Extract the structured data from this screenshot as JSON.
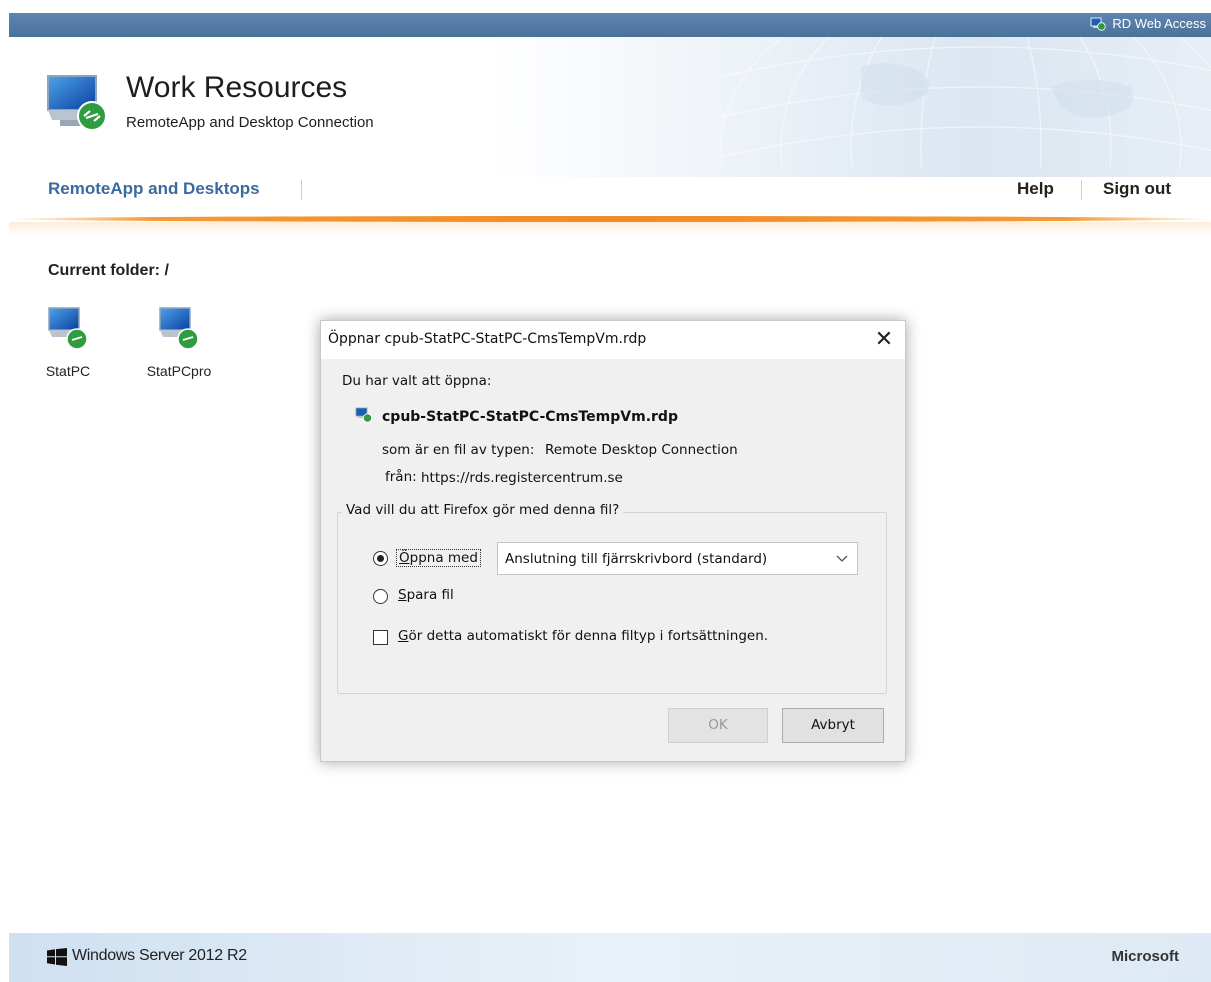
{
  "topbar": {
    "title": "RD Web Access"
  },
  "header": {
    "title": "Work Resources",
    "subtitle": "RemoteApp and Desktop Connection"
  },
  "nav": {
    "main_link": "RemoteApp and Desktops",
    "help": "Help",
    "sign_out": "Sign out"
  },
  "folder": {
    "label": "Current folder: /"
  },
  "resources": [
    {
      "label": "StatPC",
      "icon": "remote-desktop-icon"
    },
    {
      "label": "StatPCpro",
      "icon": "remote-desktop-icon"
    }
  ],
  "dialog": {
    "title": "Öppnar cpub-StatPC-StatPC-CmsTempVm.rdp",
    "chose_text": "Du har valt att öppna:",
    "file_name": "cpub-StatPC-StatPC-CmsTempVm.rdp",
    "type_label": "som är en fil av typen:",
    "type_value": "Remote Desktop Connection",
    "from_label": "från:",
    "from_value": "https://rds.registercentrum.se",
    "question": "Vad vill du att Firefox gör med denna fil?",
    "open_with": {
      "accel": "Ö",
      "rest": "ppna med",
      "checked": true
    },
    "open_with_app": "Anslutning till fjärrskrivbord (standard)",
    "save_file": {
      "accel": "S",
      "rest": "para fil",
      "checked": false
    },
    "auto": {
      "accel": "G",
      "rest": "ör detta automatiskt för denna filtyp i fortsättningen.",
      "checked": false
    },
    "ok_label": "OK",
    "cancel_label": "Avbryt"
  },
  "footer": {
    "left": "Windows Server 2012 R2",
    "right": "Microsoft"
  },
  "colors": {
    "nav_link": "#3b6aa0",
    "topbar": "#4a7299",
    "accent_orange": "#f08c28",
    "dialog_bg": "#f0f0f0"
  }
}
